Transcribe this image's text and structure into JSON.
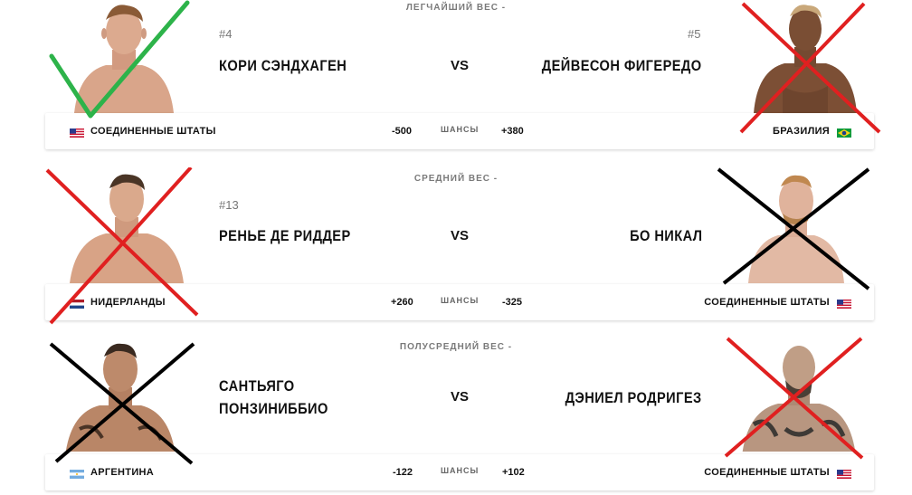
{
  "fights": [
    {
      "weight_class": "ЛЕГЧАЙШИЙ ВЕС -",
      "odds_label": "ШАНСЫ",
      "vs": "VS",
      "left": {
        "rank": "#4",
        "name": "КОРИ СЭНДХАГЕН",
        "country": "СОЕДИНЕННЫЕ ШТАТЫ",
        "odds": "-500",
        "flag": "us-flag-icon",
        "mark": "green-check-icon",
        "mark_color": "#2db34a"
      },
      "right": {
        "rank": "#5",
        "name": "ДЕЙВЕСОН ФИГЕРЕДО",
        "country": "БРАЗИЛИЯ",
        "odds": "+380",
        "flag": "brazil-flag-icon",
        "mark": "red-cross-icon",
        "mark_color": "#e02020"
      }
    },
    {
      "weight_class": "СРЕДНИЙ ВЕС -",
      "odds_label": "ШАНСЫ",
      "vs": "VS",
      "left": {
        "rank": "#13",
        "name": "РЕНЬЕ ДЕ РИДДЕР",
        "country": "НИДЕРЛАНДЫ",
        "odds": "+260",
        "flag": "netherlands-flag-icon",
        "mark": "red-cross-icon",
        "mark_color": "#e02020"
      },
      "right": {
        "rank": "",
        "name": "БО НИКАЛ",
        "country": "СОЕДИНЕННЫЕ ШТАТЫ",
        "odds": "-325",
        "flag": "us-flag-icon",
        "mark": "black-cross-icon",
        "mark_color": "#000000"
      }
    },
    {
      "weight_class": "ПОЛУСРЕДНИЙ ВЕС -",
      "odds_label": "ШАНСЫ",
      "vs": "VS",
      "left": {
        "rank": "",
        "name_line1": "САНТЬЯГО",
        "name_line2": "ПОНЗИНИББИО",
        "country": "АРГЕНТИНА",
        "odds": "-122",
        "flag": "argentina-flag-icon",
        "mark": "black-cross-icon",
        "mark_color": "#000000"
      },
      "right": {
        "rank": "",
        "name": "ДЭНИЕЛ РОДРИГЕЗ",
        "country": "СОЕДИНЕННЫЕ ШТАТЫ",
        "odds": "+102",
        "flag": "us-flag-icon",
        "mark": "red-cross-icon",
        "mark_color": "#e02020"
      }
    }
  ]
}
